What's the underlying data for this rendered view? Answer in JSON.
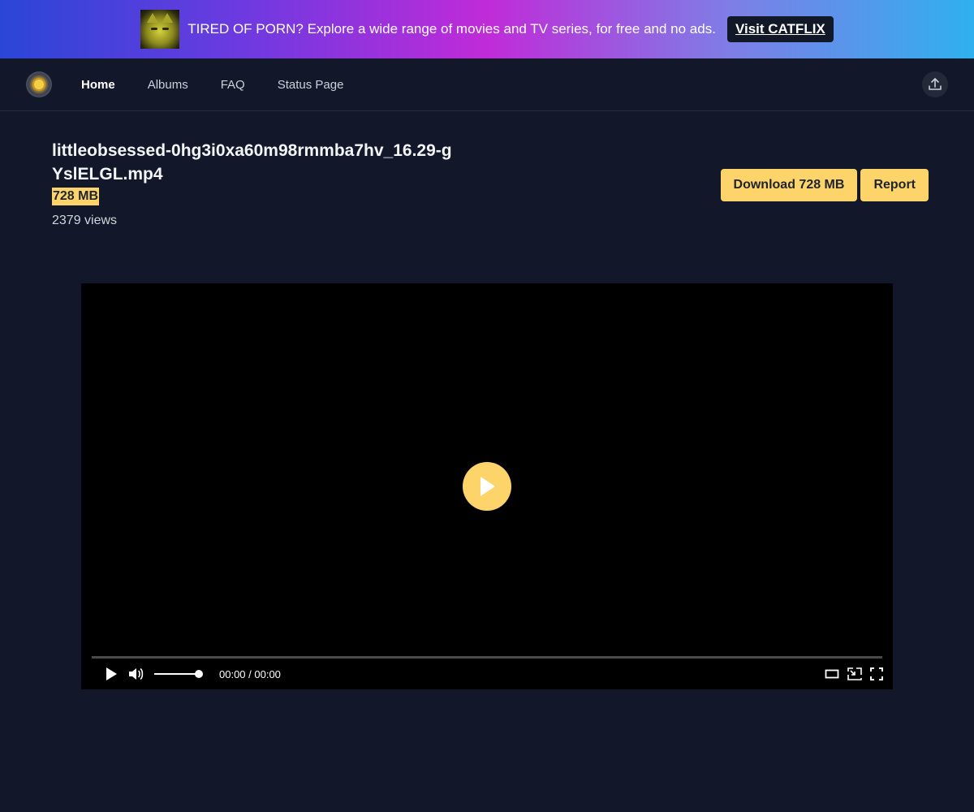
{
  "banner": {
    "text": "TIRED OF PORN? Explore a wide range of movies and TV series, for free and no ads.",
    "cta_label": "Visit CATFLIX",
    "thumbnail_icon": "cat-thumbnail"
  },
  "nav": {
    "logo_icon": "sun-logo-icon",
    "items": [
      {
        "label": "Home",
        "active": true
      },
      {
        "label": "Albums",
        "active": false
      },
      {
        "label": "FAQ",
        "active": false
      },
      {
        "label": "Status Page",
        "active": false
      }
    ],
    "upload_icon": "upload-icon"
  },
  "file": {
    "title": "littleobsessed-0hg3i0xa60m98rmmba7hv_16.29-gYslELGL.mp4",
    "size": "728 MB",
    "views": "2379 views"
  },
  "actions": {
    "download_label": "Download 728 MB",
    "report_label": "Report"
  },
  "player": {
    "time": "00:00 / 00:00",
    "volume_level": 1.0,
    "progress": 0
  },
  "colors": {
    "accent": "#fcd46a",
    "background": "#121829",
    "video": "#000000"
  }
}
